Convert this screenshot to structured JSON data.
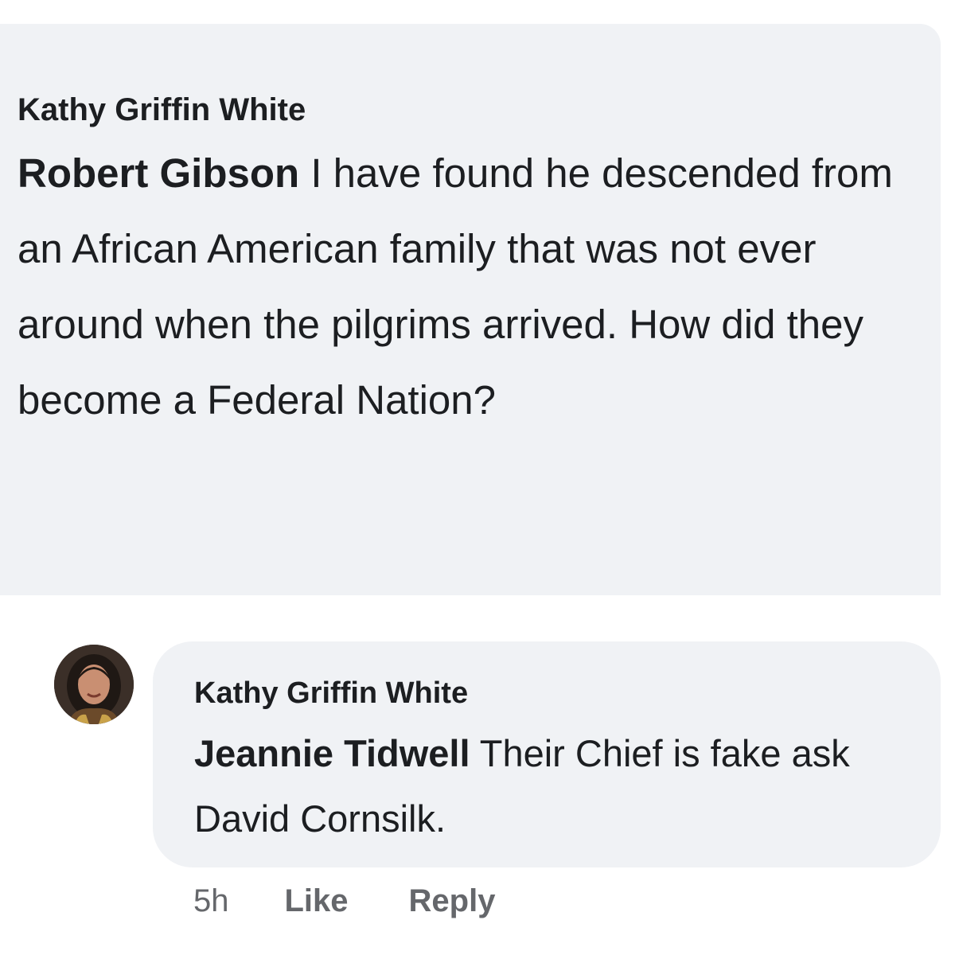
{
  "parent_comment": {
    "author": "Kathy Griffin White",
    "mention": "Robert Gibson",
    "text": " I have found he descended from an African American family that was not ever around when the pilgrims arrived. How did they become a Federal Nation?"
  },
  "reply": {
    "author": "Kathy Griffin White",
    "mention": "Jeannie Tidwell",
    "text": " Their Chief is fake ask David Cornsilk.",
    "avatar_icon": "profile-photo",
    "timestamp": "5h",
    "like_label": "Like",
    "reply_label": "Reply"
  },
  "colors": {
    "bubble": "#f0f2f5",
    "text": "#1c1e21",
    "meta": "#65676b"
  }
}
